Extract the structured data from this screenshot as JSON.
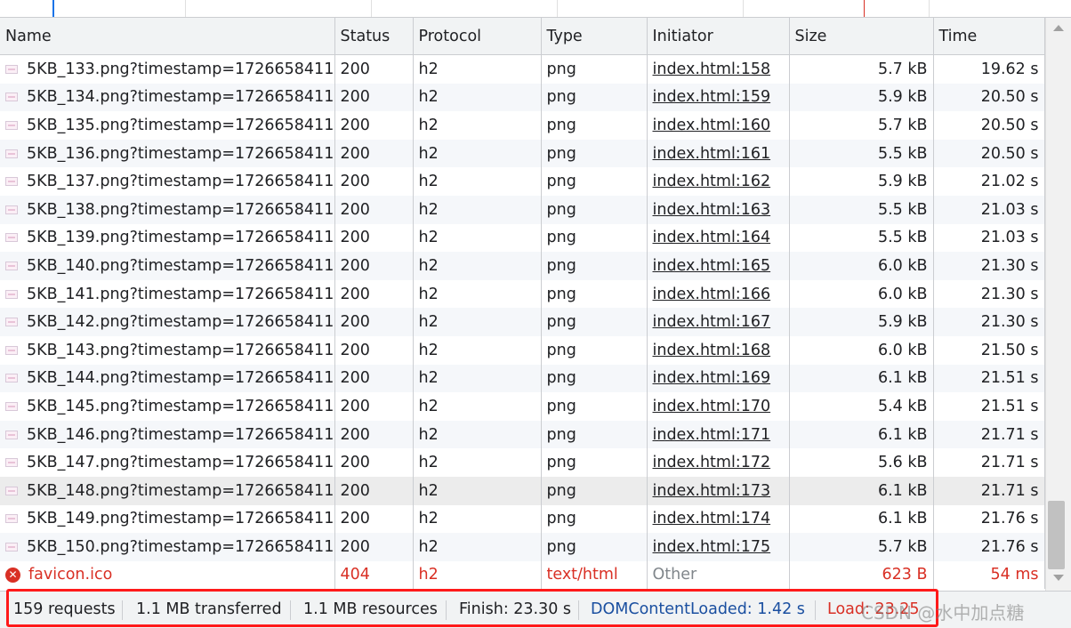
{
  "columns": [
    "Name",
    "Status",
    "Protocol",
    "Type",
    "Initiator",
    "Size",
    "Time"
  ],
  "rows": [
    {
      "name": "5KB_133.png?timestamp=1726658411",
      "status": "200",
      "protocol": "h2",
      "type": "png",
      "initiator": "index.html:158",
      "size": "5.7 kB",
      "time": "19.62 s"
    },
    {
      "name": "5KB_134.png?timestamp=1726658411",
      "status": "200",
      "protocol": "h2",
      "type": "png",
      "initiator": "index.html:159",
      "size": "5.9 kB",
      "time": "20.50 s"
    },
    {
      "name": "5KB_135.png?timestamp=1726658411",
      "status": "200",
      "protocol": "h2",
      "type": "png",
      "initiator": "index.html:160",
      "size": "5.7 kB",
      "time": "20.50 s"
    },
    {
      "name": "5KB_136.png?timestamp=1726658411",
      "status": "200",
      "protocol": "h2",
      "type": "png",
      "initiator": "index.html:161",
      "size": "5.5 kB",
      "time": "20.50 s"
    },
    {
      "name": "5KB_137.png?timestamp=1726658411",
      "status": "200",
      "protocol": "h2",
      "type": "png",
      "initiator": "index.html:162",
      "size": "5.9 kB",
      "time": "21.02 s"
    },
    {
      "name": "5KB_138.png?timestamp=1726658411",
      "status": "200",
      "protocol": "h2",
      "type": "png",
      "initiator": "index.html:163",
      "size": "5.5 kB",
      "time": "21.03 s"
    },
    {
      "name": "5KB_139.png?timestamp=1726658411",
      "status": "200",
      "protocol": "h2",
      "type": "png",
      "initiator": "index.html:164",
      "size": "5.5 kB",
      "time": "21.03 s"
    },
    {
      "name": "5KB_140.png?timestamp=1726658411",
      "status": "200",
      "protocol": "h2",
      "type": "png",
      "initiator": "index.html:165",
      "size": "6.0 kB",
      "time": "21.30 s"
    },
    {
      "name": "5KB_141.png?timestamp=1726658411",
      "status": "200",
      "protocol": "h2",
      "type": "png",
      "initiator": "index.html:166",
      "size": "6.0 kB",
      "time": "21.30 s"
    },
    {
      "name": "5KB_142.png?timestamp=1726658411",
      "status": "200",
      "protocol": "h2",
      "type": "png",
      "initiator": "index.html:167",
      "size": "5.9 kB",
      "time": "21.30 s"
    },
    {
      "name": "5KB_143.png?timestamp=1726658411",
      "status": "200",
      "protocol": "h2",
      "type": "png",
      "initiator": "index.html:168",
      "size": "6.0 kB",
      "time": "21.50 s"
    },
    {
      "name": "5KB_144.png?timestamp=1726658411",
      "status": "200",
      "protocol": "h2",
      "type": "png",
      "initiator": "index.html:169",
      "size": "6.1 kB",
      "time": "21.51 s"
    },
    {
      "name": "5KB_145.png?timestamp=1726658411",
      "status": "200",
      "protocol": "h2",
      "type": "png",
      "initiator": "index.html:170",
      "size": "5.4 kB",
      "time": "21.51 s"
    },
    {
      "name": "5KB_146.png?timestamp=1726658411",
      "status": "200",
      "protocol": "h2",
      "type": "png",
      "initiator": "index.html:171",
      "size": "6.1 kB",
      "time": "21.71 s"
    },
    {
      "name": "5KB_147.png?timestamp=1726658411",
      "status": "200",
      "protocol": "h2",
      "type": "png",
      "initiator": "index.html:172",
      "size": "5.6 kB",
      "time": "21.71 s"
    },
    {
      "name": "5KB_148.png?timestamp=1726658411",
      "status": "200",
      "protocol": "h2",
      "type": "png",
      "initiator": "index.html:173",
      "size": "6.1 kB",
      "time": "21.71 s"
    },
    {
      "name": "5KB_149.png?timestamp=1726658411",
      "status": "200",
      "protocol": "h2",
      "type": "png",
      "initiator": "index.html:174",
      "size": "6.1 kB",
      "time": "21.76 s"
    },
    {
      "name": "5KB_150.png?timestamp=1726658411",
      "status": "200",
      "protocol": "h2",
      "type": "png",
      "initiator": "index.html:175",
      "size": "5.7 kB",
      "time": "21.76 s"
    },
    {
      "name": "favicon.ico",
      "status": "404",
      "protocol": "h2",
      "type": "text/html",
      "initiator": "Other",
      "size": "623 B",
      "time": "54 ms"
    }
  ],
  "status_bar": {
    "requests": "159 requests",
    "transferred": "1.1 MB transferred",
    "resources": "1.1 MB resources",
    "finish": "Finish: 23.30 s",
    "dom_content_loaded": "DOMContentLoaded: 1.42 s",
    "load": "Load: 23.25"
  },
  "watermark": "CSDN @水中加点糖",
  "colors": {
    "error": "#d93025",
    "dcl_blue": "#1a4fa0",
    "highlight_box": "#ff1a1a"
  },
  "icons": {
    "file_row": "image-file-icon",
    "error_row": "error-circle-icon"
  }
}
